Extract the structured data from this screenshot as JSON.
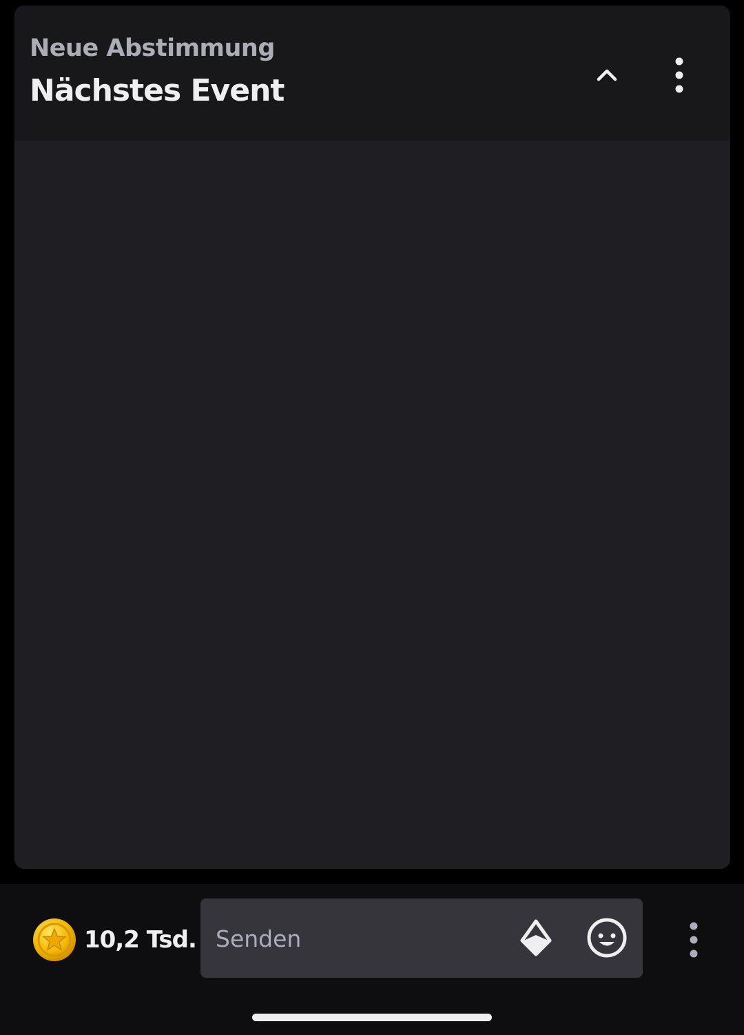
{
  "poll": {
    "subtitle": "Neue Abstimmung",
    "title": "Nächstes Event",
    "collapse_icon": "chevron-up-icon",
    "menu_icon": "more-vertical-icon"
  },
  "bottom_bar": {
    "channel_points": "10,2 Tsd.",
    "chat_placeholder": "Senden",
    "bits_icon": "bits-icon",
    "emote_icon": "emote-smiley-icon",
    "menu_icon": "more-vertical-icon"
  },
  "colors": {
    "background": "#000000",
    "panel": "#1f1f23",
    "header": "#18181b",
    "input": "#35353b",
    "text": "#efeff1",
    "muted_text": "#adadb8",
    "coin": "#f5b800"
  }
}
